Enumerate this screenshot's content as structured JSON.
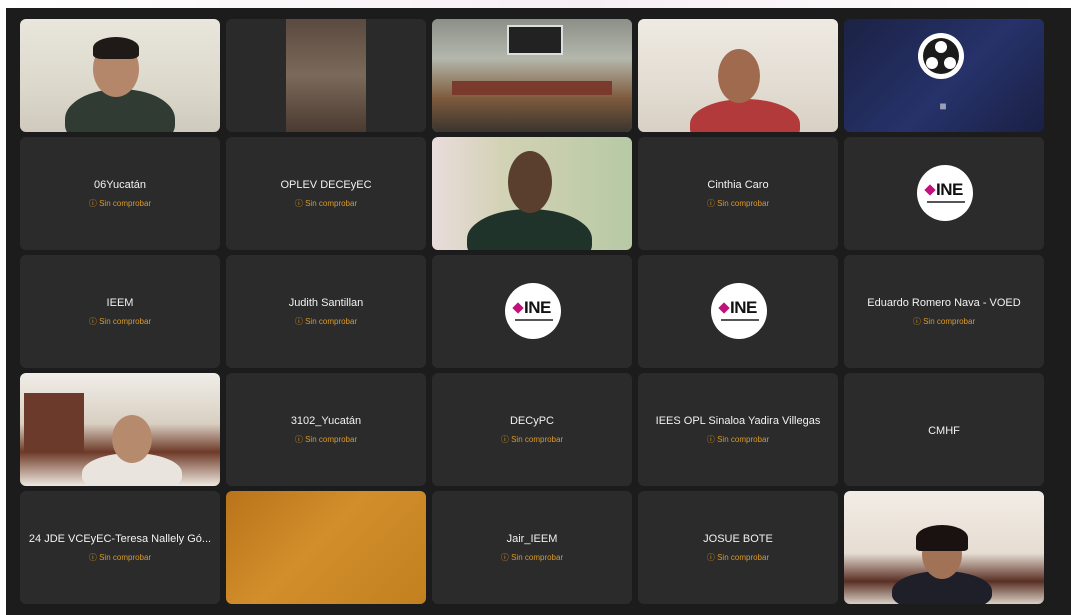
{
  "window": {
    "title": ""
  },
  "participants": [
    {
      "id": "p1",
      "type": "video"
    },
    {
      "id": "p2",
      "type": "video"
    },
    {
      "id": "p3",
      "type": "video",
      "active_speaker": true
    },
    {
      "id": "p4",
      "type": "video"
    },
    {
      "id": "p5",
      "type": "obs-camera-off",
      "icon": "obs-logo-icon"
    },
    {
      "id": "p6",
      "type": "name",
      "name": "06Yucatán",
      "status": "Sin comprobar"
    },
    {
      "id": "p7",
      "type": "name",
      "name": "OPLEV DECEyEC",
      "status": "Sin comprobar"
    },
    {
      "id": "p8",
      "type": "video"
    },
    {
      "id": "p9",
      "type": "name",
      "name": "Cinthia Caro",
      "status": "Sin comprobar"
    },
    {
      "id": "p10",
      "type": "logo",
      "logo_text": "INE"
    },
    {
      "id": "p11",
      "type": "name",
      "name": "IEEM",
      "status": "Sin comprobar"
    },
    {
      "id": "p12",
      "type": "name",
      "name": "Judith Santillan",
      "status": "Sin comprobar"
    },
    {
      "id": "p13",
      "type": "logo",
      "logo_text": "INE"
    },
    {
      "id": "p14",
      "type": "logo",
      "logo_text": "INE"
    },
    {
      "id": "p15",
      "type": "name",
      "name": "Eduardo Romero Nava - VOED",
      "status": "Sin comprobar"
    },
    {
      "id": "p16",
      "type": "video"
    },
    {
      "id": "p17",
      "type": "name",
      "name": "3102_Yucatán",
      "status": "Sin comprobar"
    },
    {
      "id": "p18",
      "type": "name",
      "name": "DECyPC",
      "status": "Sin comprobar"
    },
    {
      "id": "p19",
      "type": "name",
      "name": "IEES OPL Sinaloa Yadira Villegas",
      "status": "Sin comprobar"
    },
    {
      "id": "p20",
      "type": "name-only",
      "name": "CMHF"
    },
    {
      "id": "p21",
      "type": "name",
      "name": "24 JDE VCEyEC-Teresa Nallely Gó...",
      "status": "Sin comprobar"
    },
    {
      "id": "p22",
      "type": "video"
    },
    {
      "id": "p23",
      "type": "name",
      "name": "Jair_IEEM",
      "status": "Sin comprobar"
    },
    {
      "id": "p24",
      "type": "name",
      "name": "JOSUE BOTE",
      "status": "Sin comprobar"
    },
    {
      "id": "p25",
      "type": "video"
    }
  ],
  "colors": {
    "background": "#1c1c1c",
    "tile": "#2b2b2b",
    "status": "#d99a29",
    "active_outline": "#3fbfa0",
    "ine_magenta": "#c0127a"
  }
}
